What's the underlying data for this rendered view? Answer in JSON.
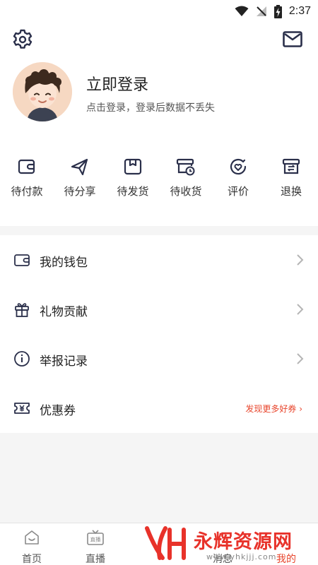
{
  "status_bar": {
    "time": "2:37"
  },
  "header": {
    "settings_icon": "gear-icon",
    "message_icon": "mail-icon"
  },
  "profile": {
    "title": "立即登录",
    "subtitle": "点击登录，登录后数据不丢失"
  },
  "orders": [
    {
      "label": "待付款",
      "icon": "wallet-icon"
    },
    {
      "label": "待分享",
      "icon": "send-icon"
    },
    {
      "label": "待发货",
      "icon": "package-icon"
    },
    {
      "label": "待收货",
      "icon": "box-clock-icon"
    },
    {
      "label": "评价",
      "icon": "review-heart-icon"
    },
    {
      "label": "退换",
      "icon": "exchange-icon"
    }
  ],
  "menu": [
    {
      "label": "我的钱包",
      "icon": "wallet-icon"
    },
    {
      "label": "礼物贡献",
      "icon": "gift-icon"
    },
    {
      "label": "举报记录",
      "icon": "info-icon"
    },
    {
      "label": "优惠券",
      "icon": "coupon-icon",
      "extra": "发现更多好券 ›"
    }
  ],
  "tabs": [
    {
      "label": "首页",
      "icon": "home-icon"
    },
    {
      "label": "直播",
      "icon": "tv-icon",
      "icon_text": "直播"
    },
    {
      "label": "消息",
      "icon": "message-icon"
    },
    {
      "label": "我的",
      "icon": "profile-icon",
      "active": true
    }
  ],
  "watermark": {
    "text": "永辉资源网",
    "url": "www.yhkjjj.com"
  },
  "colors": {
    "accent": "#e8452c",
    "background": "#f5f5f5",
    "card": "#ffffff",
    "avatar_bg": "#f6d8c2"
  }
}
